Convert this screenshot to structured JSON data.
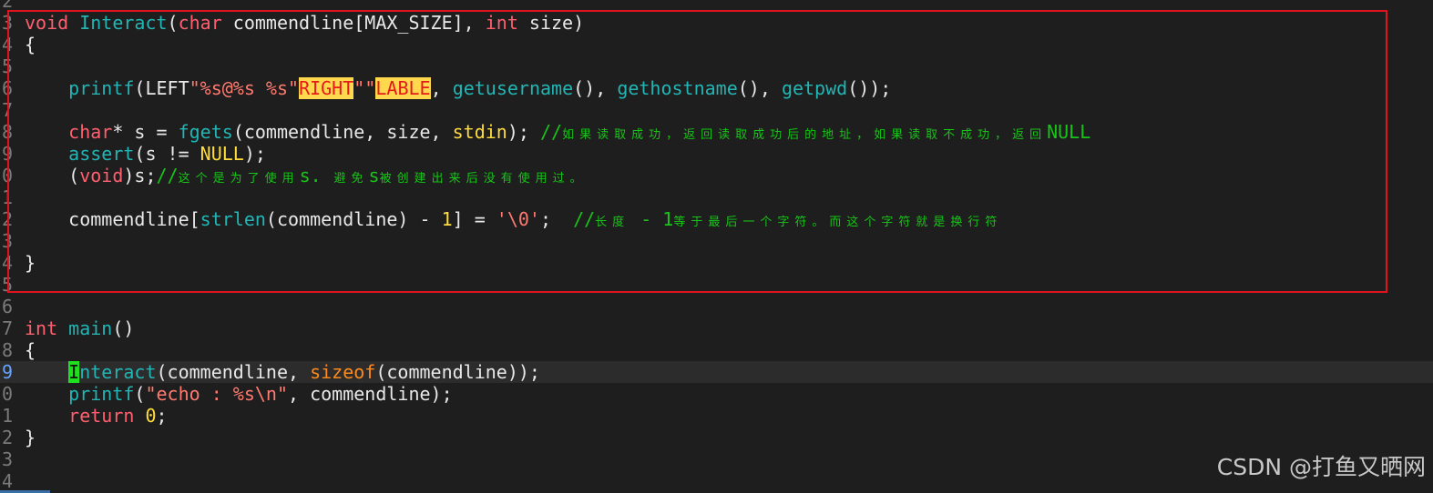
{
  "editor": {
    "lines": [
      {
        "no": "2",
        "segments": []
      },
      {
        "no": "3",
        "segments": [
          {
            "c": "kw",
            "t": "void"
          },
          {
            "c": "",
            "t": " "
          },
          {
            "c": "fn",
            "t": "Interact"
          },
          {
            "c": "",
            "t": "("
          },
          {
            "c": "kw",
            "t": "char"
          },
          {
            "c": "",
            "t": " commendline[MAX_SIZE], "
          },
          {
            "c": "kw",
            "t": "int"
          },
          {
            "c": "",
            "t": " size)"
          }
        ]
      },
      {
        "no": "4",
        "segments": [
          {
            "c": "",
            "t": "{"
          }
        ]
      },
      {
        "no": "5",
        "segments": []
      },
      {
        "no": "6",
        "segments": [
          {
            "c": "",
            "t": "    "
          },
          {
            "c": "fn",
            "t": "printf"
          },
          {
            "c": "",
            "t": "(LEFT"
          },
          {
            "c": "str",
            "t": "\"%s@%s %s\""
          },
          {
            "c": "macro-hl",
            "t": "RIGHT"
          },
          {
            "c": "str",
            "t": "\"\""
          },
          {
            "c": "macro-hl",
            "t": "LABLE"
          },
          {
            "c": "",
            "t": ", "
          },
          {
            "c": "fn",
            "t": "getusername"
          },
          {
            "c": "",
            "t": "(), "
          },
          {
            "c": "fn",
            "t": "gethostname"
          },
          {
            "c": "",
            "t": "(), "
          },
          {
            "c": "fn",
            "t": "getpwd"
          },
          {
            "c": "",
            "t": "());"
          }
        ]
      },
      {
        "no": "7",
        "segments": []
      },
      {
        "no": "8",
        "segments": [
          {
            "c": "",
            "t": "    "
          },
          {
            "c": "kw",
            "t": "char"
          },
          {
            "c": "",
            "t": "* s = "
          },
          {
            "c": "fn",
            "t": "fgets"
          },
          {
            "c": "",
            "t": "(commendline, size, "
          },
          {
            "c": "const",
            "t": "stdin"
          },
          {
            "c": "",
            "t": "); "
          },
          {
            "c": "cmt",
            "t": "//"
          },
          {
            "c": "cmt-cjk",
            "t": "如果读取成功，返回读取成功后的地址，如果读取不成功，返回"
          },
          {
            "c": "cmt",
            "t": "NULL"
          }
        ]
      },
      {
        "no": "9",
        "segments": [
          {
            "c": "",
            "t": "    "
          },
          {
            "c": "fn",
            "t": "assert"
          },
          {
            "c": "",
            "t": "(s != "
          },
          {
            "c": "const",
            "t": "NULL"
          },
          {
            "c": "",
            "t": ");"
          }
        ]
      },
      {
        "no": "0",
        "segments": [
          {
            "c": "",
            "t": "    ("
          },
          {
            "c": "kw",
            "t": "void"
          },
          {
            "c": "",
            "t": ")s;"
          },
          {
            "c": "cmt",
            "t": "//"
          },
          {
            "c": "cmt-cjk",
            "t": "这个是为了使用"
          },
          {
            "c": "cmt",
            "t": "s."
          },
          {
            "c": "cmt-cjk",
            "t": " 避免"
          },
          {
            "c": "cmt",
            "t": "s"
          },
          {
            "c": "cmt-cjk",
            "t": "被创建出来后没有使用过。"
          }
        ]
      },
      {
        "no": "1",
        "segments": []
      },
      {
        "no": "2",
        "segments": [
          {
            "c": "",
            "t": "    commendline["
          },
          {
            "c": "fn",
            "t": "strlen"
          },
          {
            "c": "",
            "t": "(commendline) - "
          },
          {
            "c": "num",
            "t": "1"
          },
          {
            "c": "",
            "t": "] = "
          },
          {
            "c": "str",
            "t": "'\\0'"
          },
          {
            "c": "",
            "t": ";  "
          },
          {
            "c": "cmt",
            "t": "//"
          },
          {
            "c": "cmt-cjk",
            "t": "长度"
          },
          {
            "c": "cmt",
            "t": " - 1"
          },
          {
            "c": "cmt-cjk",
            "t": "等于最后一个字符。而这个字符就是换行符"
          }
        ]
      },
      {
        "no": "3",
        "segments": []
      },
      {
        "no": "4",
        "segments": [
          {
            "c": "",
            "t": "}"
          }
        ]
      },
      {
        "no": "5",
        "segments": []
      },
      {
        "no": "6",
        "segments": []
      },
      {
        "no": "7",
        "segments": [
          {
            "c": "kw",
            "t": "int"
          },
          {
            "c": "",
            "t": " "
          },
          {
            "c": "fn",
            "t": "main"
          },
          {
            "c": "",
            "t": "()"
          }
        ]
      },
      {
        "no": "8",
        "segments": [
          {
            "c": "",
            "t": "{"
          }
        ]
      },
      {
        "no": "9",
        "current": true,
        "segments": [
          {
            "c": "",
            "t": "    "
          },
          {
            "c": "cursor",
            "t": "I"
          },
          {
            "c": "fn",
            "t": "nteract"
          },
          {
            "c": "",
            "t": "(commendline, "
          },
          {
            "c": "szof",
            "t": "sizeof"
          },
          {
            "c": "",
            "t": "(commendline));"
          }
        ]
      },
      {
        "no": "0",
        "segments": [
          {
            "c": "",
            "t": "    "
          },
          {
            "c": "fn",
            "t": "printf"
          },
          {
            "c": "",
            "t": "("
          },
          {
            "c": "str",
            "t": "\"echo : %s\\n\""
          },
          {
            "c": "",
            "t": ", commendline);"
          }
        ]
      },
      {
        "no": "1",
        "segments": [
          {
            "c": "",
            "t": "    "
          },
          {
            "c": "kw",
            "t": "return"
          },
          {
            "c": "",
            "t": " "
          },
          {
            "c": "num",
            "t": "0"
          },
          {
            "c": "",
            "t": ";"
          }
        ]
      },
      {
        "no": "2",
        "segments": [
          {
            "c": "",
            "t": "}"
          }
        ]
      },
      {
        "no": "3",
        "segments": []
      },
      {
        "no": "4",
        "segments": []
      }
    ]
  },
  "watermark": "CSDN @打鱼又晒网",
  "colors": {
    "background": "#1e1e1e",
    "keyword": "#ff5f6e",
    "function": "#22b5b5",
    "comment": "#18c418",
    "highlight_box": "#e0141e"
  }
}
